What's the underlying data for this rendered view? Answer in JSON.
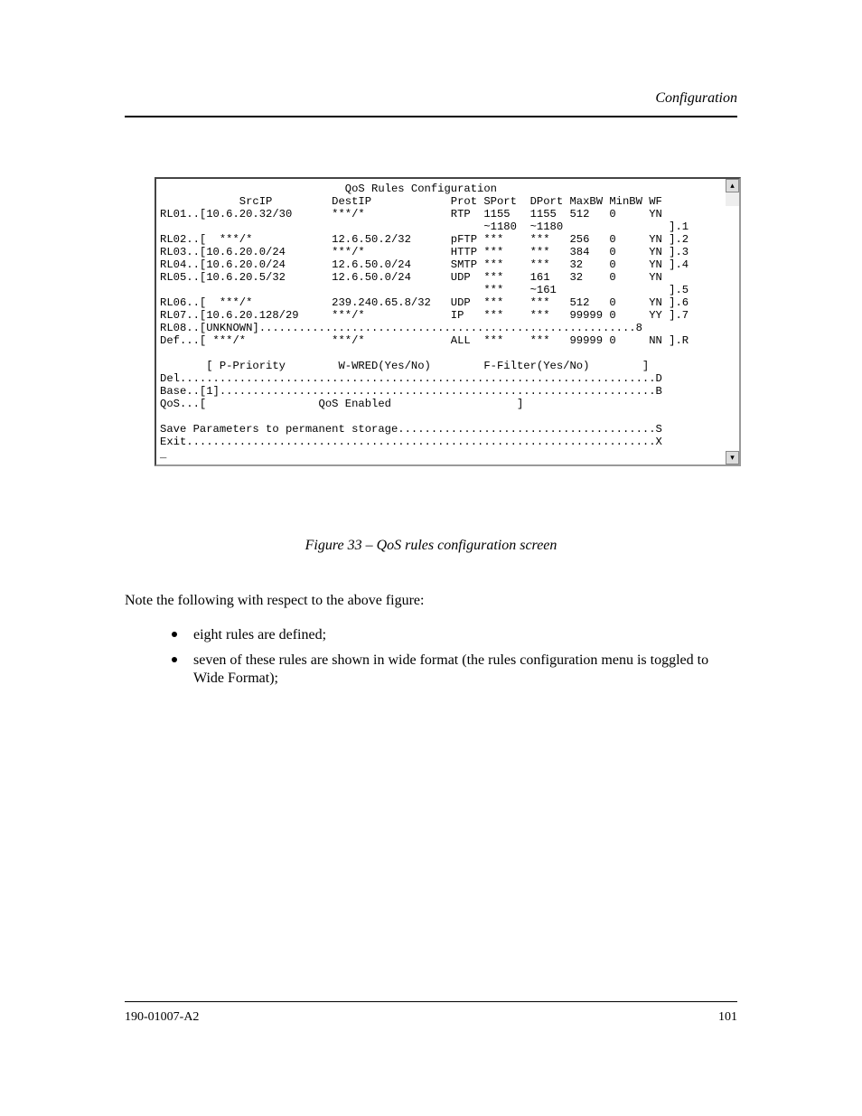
{
  "header": {
    "right": "Configuration"
  },
  "footer": {
    "left": "190-01007-A2",
    "right": "101"
  },
  "terminal": {
    "title": "QoS Rules Configuration",
    "cols": {
      "c0": "SrcIP",
      "c1": "DestIP",
      "c2": "Prot",
      "c3": "SPort",
      "c4": "DPort",
      "c5": "MaxBW",
      "c6": "MinBW",
      "c7": "WF"
    },
    "rows": [
      {
        "id": "RL01",
        "src": "[10.6.20.32/30",
        "dst": "***/*",
        "prot": "RTP",
        "sp": "1155",
        "dp": "1155",
        "max": "512",
        "min": "0",
        "wf": "YN",
        "sfx": ""
      },
      {
        "id": "",
        "src": "",
        "dst": "",
        "prot": "",
        "sp": "~1180",
        "dp": "~1180",
        "max": "",
        "min": "",
        "wf": "",
        "sfx": "].1"
      },
      {
        "id": "RL02",
        "src": "[  ***/*",
        "dst": "12.6.50.2/32",
        "prot": "pFTP",
        "sp": "***",
        "dp": "***",
        "max": "256",
        "min": "0",
        "wf": "YN",
        "sfx": "].2"
      },
      {
        "id": "RL03",
        "src": "[10.6.20.0/24",
        "dst": "***/*",
        "prot": "HTTP",
        "sp": "***",
        "dp": "***",
        "max": "384",
        "min": "0",
        "wf": "YN",
        "sfx": "].3"
      },
      {
        "id": "RL04",
        "src": "[10.6.20.0/24",
        "dst": "12.6.50.0/24",
        "prot": "SMTP",
        "sp": "***",
        "dp": "***",
        "max": "32",
        "min": "0",
        "wf": "YN",
        "sfx": "].4"
      },
      {
        "id": "RL05",
        "src": "[10.6.20.5/32",
        "dst": "12.6.50.0/24",
        "prot": "UDP",
        "sp": "***",
        "dp": "161",
        "max": "32",
        "min": "0",
        "wf": "YN",
        "sfx": ""
      },
      {
        "id": "",
        "src": "",
        "dst": "",
        "prot": "",
        "sp": "***",
        "dp": "~161",
        "max": "",
        "min": "",
        "wf": "",
        "sfx": "].5"
      },
      {
        "id": "RL06",
        "src": "[  ***/*",
        "dst": "239.240.65.8/32",
        "prot": "UDP",
        "sp": "***",
        "dp": "***",
        "max": "512",
        "min": "0",
        "wf": "YN",
        "sfx": "].6"
      },
      {
        "id": "RL07",
        "src": "[10.6.20.128/29",
        "dst": "***/*",
        "prot": "IP",
        "sp": "***",
        "dp": "***",
        "max": "99999",
        "min": "0",
        "wf": "YY",
        "sfx": "].7"
      }
    ],
    "rl08": "RL08..[UNKNOWN].........................................................8",
    "def_row": {
      "id": "Def",
      "src": "***/*",
      "dst": "***/*",
      "prot": "ALL",
      "sp": "***",
      "dp": "***",
      "max": "99999",
      "min": "0",
      "wf": "NN",
      "sfx": "].R"
    },
    "legend_p": "P-Priority",
    "legend_w": "W-WRED(Yes/No)",
    "legend_f": "F-Filter(Yes/No)",
    "legend_close": "]",
    "del_line": "Del........................................................................D",
    "base_line": "Base..[1]..................................................................B",
    "qos_line_lbl": "QoS...[",
    "qos_line_val": "QoS Enabled",
    "qos_line_close": "]",
    "save_line": "Save Parameters to permanent storage.......................................S",
    "exit_line": "Exit.......................................................................X",
    "cursor": "_"
  },
  "figure_caption": "Figure 33 – QoS rules configuration screen",
  "body1": "Note the following with respect to the above figure:",
  "bullet1": "eight rules are defined;",
  "bullet2": "seven of these rules are shown in wide format (the rules configuration menu is toggled to Wide Format);"
}
